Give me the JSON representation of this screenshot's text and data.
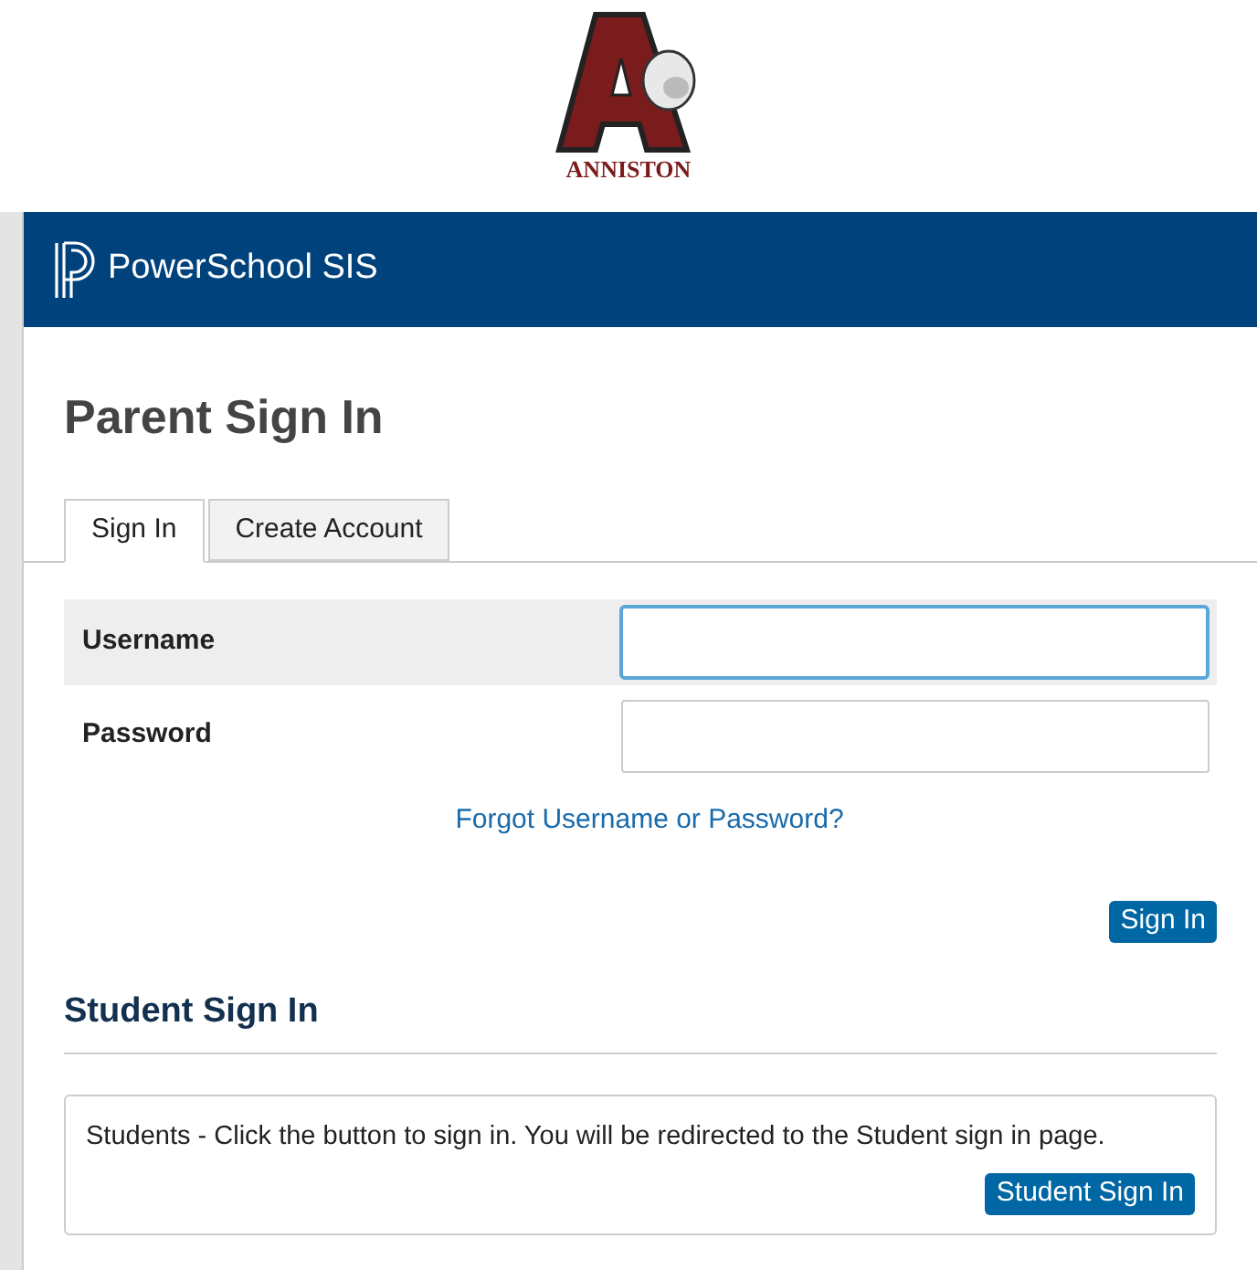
{
  "logo": {
    "name": "ANNISTON"
  },
  "header": {
    "brand": "PowerSchool SIS"
  },
  "title": "Parent Sign In",
  "tabs": [
    {
      "label": "Sign In",
      "selected": true
    },
    {
      "label": "Create Account",
      "selected": false
    }
  ],
  "fields": [
    {
      "label": "Username",
      "focused": true
    },
    {
      "label": "Password",
      "focused": false
    }
  ],
  "forgot_link": "Forgot Username or Password?",
  "sign_in_button": "Sign In",
  "student": {
    "heading": "Student Sign In",
    "message": "Students - Click the button to sign in. You will be redirected to the Student sign in page.",
    "button": "Student Sign In"
  }
}
